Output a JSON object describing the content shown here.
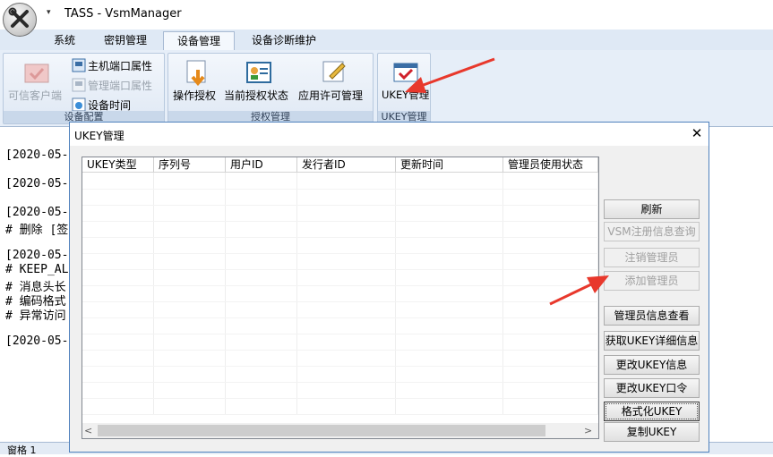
{
  "window": {
    "title": "TASS - VsmManager",
    "qa_arrow": "▾"
  },
  "tabs": [
    {
      "label": "系统"
    },
    {
      "label": "密钥管理"
    },
    {
      "label": "设备管理"
    },
    {
      "label": "设备诊断维护"
    }
  ],
  "ribbon": {
    "groups": [
      {
        "caption": "设备配置"
      },
      {
        "caption": "授权管理"
      },
      {
        "caption": "UKEY管理"
      }
    ],
    "trusted_client": "可信客户端",
    "host_port_props": "主机端口属性",
    "mgmt_port_props": "管理端口属性",
    "device_time": "设备时间",
    "op_auth": "操作授权",
    "current_auth_status": "当前授权状态",
    "app_license_mgmt": "应用许可管理",
    "ukey_mgmt": "UKEY管理"
  },
  "log": {
    "lines": [
      "[2020-05-",
      "[2020-05-",
      "[2020-05-",
      "# 删除 [签",
      "[2020-05-",
      "# KEEP_AL",
      "# 消息头长",
      "# 编码格式",
      "# 异常访问",
      "[2020-05-"
    ],
    "status": "窗格 1"
  },
  "dialog": {
    "title": "UKEY管理",
    "close": "✕",
    "columns": [
      "UKEY类型",
      "序列号",
      "用户ID",
      "发行者ID",
      "更新时间",
      "管理员使用状态"
    ],
    "buttons": {
      "refresh": "刷新",
      "vsm_reg_query": "VSM注册信息查询",
      "logout_admin": "注销管理员",
      "add_admin": "添加管理员",
      "view_admin": "管理员信息查看",
      "get_ukey_detail": "获取UKEY详细信息",
      "change_ukey_info": "更改UKEY信息",
      "change_ukey_pin": "更改UKEY口令",
      "format_ukey": "格式化UKEY",
      "copy_ukey": "复制UKEY"
    },
    "scroll_left": "<",
    "scroll_right": ">"
  },
  "colors": {
    "annotation_arrow": "#e8382c",
    "ribbon_bg": "#e6eef8",
    "dialog_border": "#4f81bd"
  }
}
